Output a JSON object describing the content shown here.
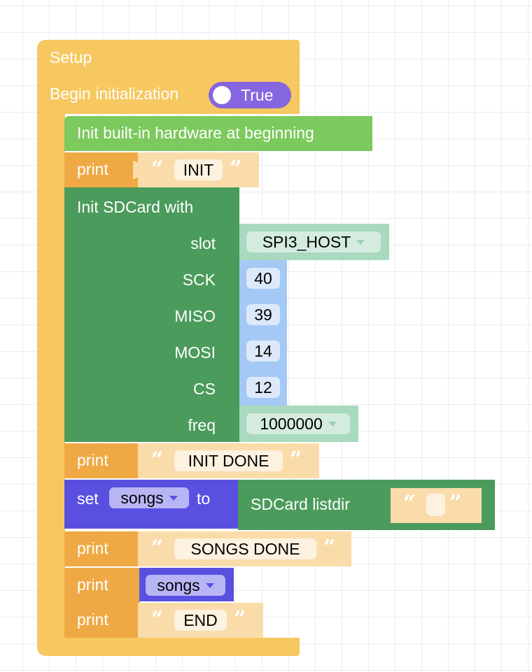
{
  "colors": {
    "setup": "#f6c85f",
    "hardware": "#7cc95e",
    "print": "#efa944",
    "string": "#fadcab",
    "string_field": "#fdf1df",
    "sdcard": "#4b9b5c",
    "dropdown": "#a9d9bf",
    "number": "#a5c9f5",
    "variable": "#5a50e0",
    "var_field": "#b8b5f5",
    "toggle": "#8566e0"
  },
  "setup": {
    "title": "Setup",
    "begin_label": "Begin initialization",
    "toggle_value": "True",
    "toggle_on": true
  },
  "blocks": {
    "hardware": "Init built-in hardware at beginning",
    "print_label": "print",
    "print1": "INIT",
    "sdcard": {
      "title": "Init SDCard with",
      "slot_label": "slot",
      "slot_value": "SPI3_HOST",
      "sck_label": "SCK",
      "sck_value": "40",
      "miso_label": "MISO",
      "miso_value": "39",
      "mosi_label": "MOSI",
      "mosi_value": "14",
      "cs_label": "CS",
      "cs_value": "12",
      "freq_label": "freq",
      "freq_value": "1000000"
    },
    "print2": "INIT DONE",
    "set": {
      "set_label": "set",
      "variable": "songs",
      "to_label": "to",
      "listdir_label": "SDCard listdir",
      "listdir_arg": ""
    },
    "print3": "SONGS DONE",
    "print4_var": "songs",
    "print5": "END"
  },
  "icons": {
    "quote_open": "“",
    "quote_close": "”",
    "dropdown": "triangle-down"
  }
}
